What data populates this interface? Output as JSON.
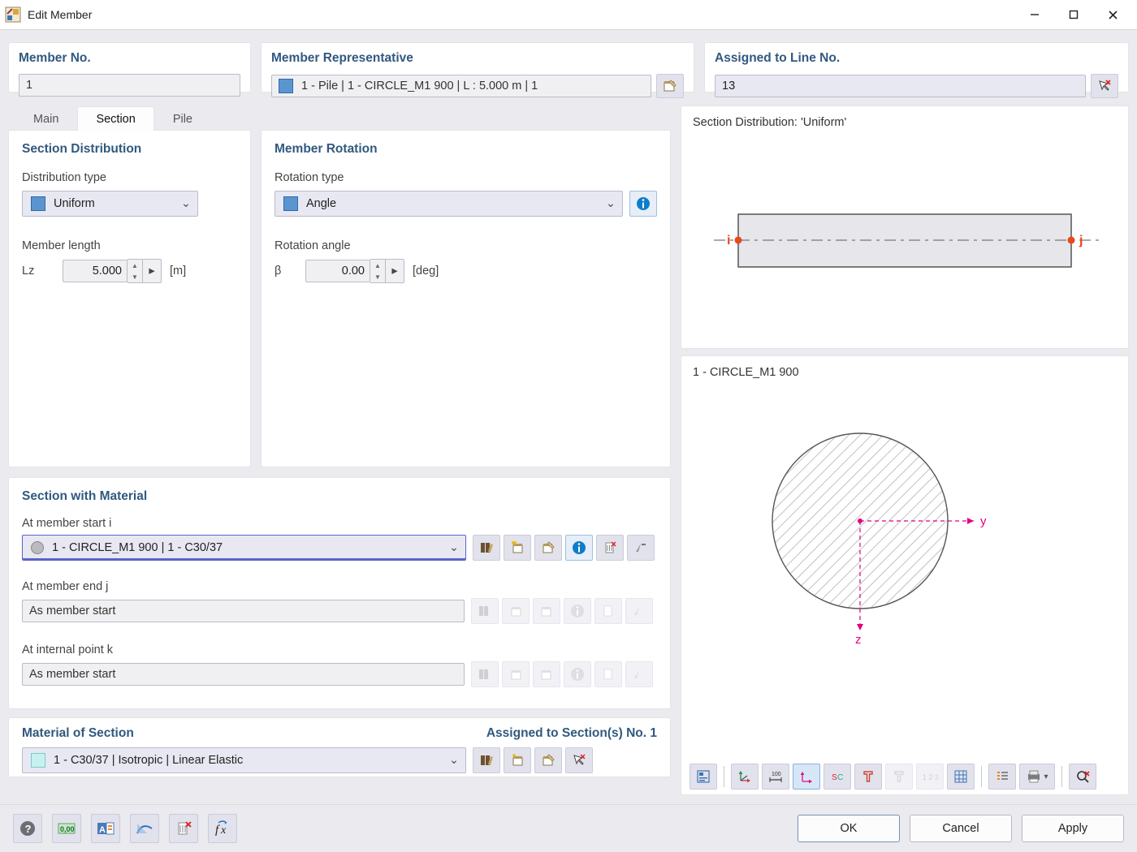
{
  "window": {
    "title": "Edit Member"
  },
  "header": {
    "member_no_title": "Member No.",
    "member_no_value": "1",
    "member_rep_title": "Member Representative",
    "member_rep_value": "1 - Pile | 1 - CIRCLE_M1 900 | L : 5.000 m | 1",
    "assigned_title": "Assigned to Line No.",
    "assigned_value": "13"
  },
  "tabs": {
    "main": "Main",
    "section": "Section",
    "pile": "Pile"
  },
  "section_distribution": {
    "title": "Section Distribution",
    "dist_type_label": "Distribution type",
    "dist_type_value": "Uniform",
    "member_length_label": "Member length",
    "length_symbol": "Lz",
    "length_value": "5.000",
    "length_unit": "[m]"
  },
  "member_rotation": {
    "title": "Member Rotation",
    "rot_type_label": "Rotation type",
    "rot_type_value": "Angle",
    "rot_angle_label": "Rotation angle",
    "angle_symbol": "β",
    "angle_value": "0.00",
    "angle_unit": "[deg]"
  },
  "section_material": {
    "title": "Section with Material",
    "start_label": "At member start i",
    "start_value": "1 - CIRCLE_M1 900 | 1 - C30/37",
    "end_label": "At member end j",
    "end_value": "As member start",
    "internal_label": "At internal point k",
    "internal_value": "As member start"
  },
  "material_section": {
    "title": "Material of Section",
    "assigned_label": "Assigned to Section(s) No. 1",
    "value": "1 - C30/37 | Isotropic | Linear Elastic"
  },
  "preview": {
    "dist_title": "Section Distribution: 'Uniform'",
    "section_title": "1 - CIRCLE_M1 900",
    "i_label": "i",
    "j_label": "j",
    "y_label": "y",
    "z_label": "z"
  },
  "footer": {
    "ok": "OK",
    "cancel": "Cancel",
    "apply": "Apply"
  },
  "colors": {
    "swatch": "#5B95D0",
    "material_swatch": "#C7F1F1"
  }
}
